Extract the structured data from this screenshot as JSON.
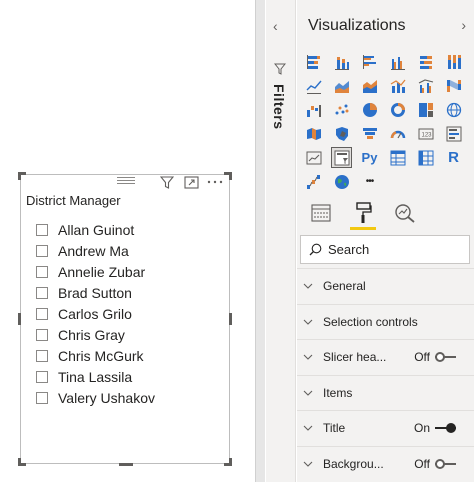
{
  "slicer": {
    "header": "District Manager",
    "items": [
      {
        "label": "Allan Guinot"
      },
      {
        "label": "Andrew Ma"
      },
      {
        "label": "Annelie Zubar"
      },
      {
        "label": "Brad Sutton"
      },
      {
        "label": "Carlos Grilo"
      },
      {
        "label": "Chris Gray"
      },
      {
        "label": "Chris McGurk"
      },
      {
        "label": "Tina Lassila"
      },
      {
        "label": "Valery Ushakov"
      }
    ],
    "toolbar_icons": [
      "filter-icon",
      "focus-mode-icon",
      "more-options-icon"
    ]
  },
  "filters": {
    "label": "Filters",
    "collapse_glyph": "‹"
  },
  "visualizations": {
    "title": "Visualizations",
    "expand_glyph": "›",
    "icons": [
      "stacked-bar-chart",
      "stacked-column-chart",
      "clustered-bar-chart",
      "clustered-column-chart",
      "100-stacked-bar-chart",
      "100-stacked-column-chart",
      "line-chart",
      "area-chart",
      "stacked-area-chart",
      "line-and-column-chart",
      "line-and-clustered-column-chart",
      "ribbon-chart",
      "waterfall-chart",
      "scatter-chart",
      "pie-chart",
      "donut-chart",
      "treemap",
      "map",
      "filled-map",
      "shape-map",
      "funnel",
      "gauge",
      "card",
      "multi-row-card",
      "kpi",
      "slicer",
      "python-visual",
      "table",
      "matrix",
      "r-visual",
      "decomposition-tree",
      "globe-map",
      "more-visuals"
    ],
    "more_glyph": "•••",
    "python_label": "Py",
    "r_label": "R",
    "selected_icon": "slicer",
    "tabs": [
      {
        "name": "fields-tab",
        "active": false
      },
      {
        "name": "format-tab",
        "active": true
      },
      {
        "name": "analytics-tab",
        "active": false
      }
    ],
    "search": {
      "placeholder": "Search",
      "value": ""
    },
    "sections": [
      {
        "label": "General"
      },
      {
        "label": "Selection controls"
      },
      {
        "label": "Slicer hea...",
        "toggle": "Off"
      },
      {
        "label": "Items"
      },
      {
        "label": "Title",
        "toggle": "On"
      },
      {
        "label": "Backgrou...",
        "toggle": "Off"
      }
    ]
  },
  "colors": {
    "accent_yellow": "#f2c811",
    "viz_blue": "#2b70c9",
    "viz_orange": "#e0843c",
    "pane_bg": "#f3f2f1"
  }
}
